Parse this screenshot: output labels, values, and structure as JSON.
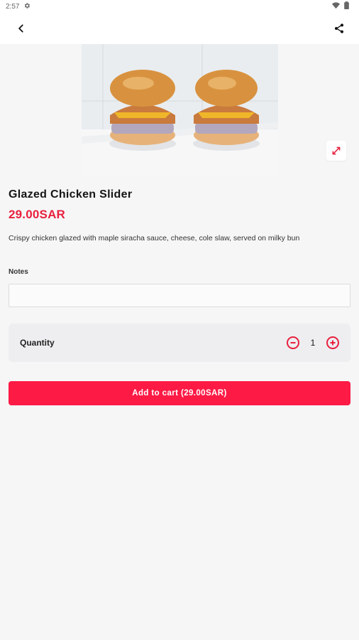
{
  "status": {
    "time": "2:57",
    "left_icons": [
      "gear-icon"
    ],
    "right_icons": [
      "wifi-icon",
      "battery-icon"
    ]
  },
  "appbar": {
    "back_icon": "back-arrow-icon",
    "share_icon": "share-icon"
  },
  "product": {
    "title": "Glazed Chicken Slider",
    "price": "29.00SAR",
    "description": "Crispy chicken glazed with maple siracha sauce, cheese, cole slaw, served on milky bun"
  },
  "notes": {
    "label": "Notes",
    "value": "",
    "placeholder": ""
  },
  "quantity": {
    "label": "Quantity",
    "value": "1",
    "minus_icon": "minus-circle-icon",
    "plus_icon": "plus-circle-icon"
  },
  "add_to_cart": {
    "label": "Add to cart (29.00SAR)"
  },
  "colors": {
    "accent": "#fd1a45",
    "price": "#e8203e",
    "background": "#f6f6f7"
  }
}
